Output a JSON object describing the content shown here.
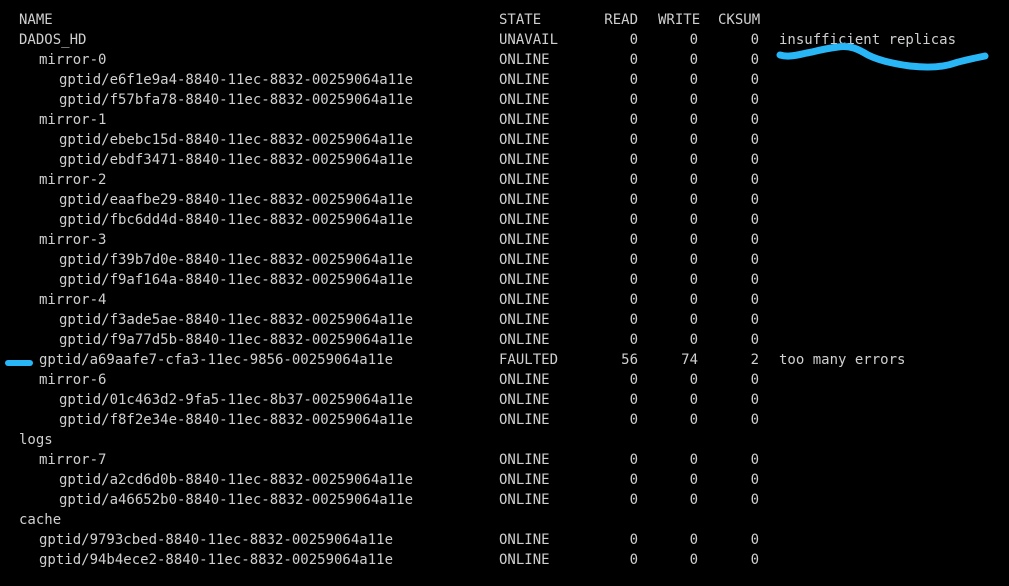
{
  "terminal": {
    "header": {
      "name": "NAME",
      "state": "STATE",
      "read": "READ",
      "write": "WRITE",
      "cksum": "CKSUM"
    },
    "rows": [
      {
        "name": "DADOS_HD",
        "state": "UNAVAIL",
        "read": "0",
        "write": "0",
        "cksum": "0",
        "msg": "insufficient replicas",
        "indent": 0
      },
      {
        "name": "mirror-0",
        "state": "ONLINE",
        "read": "0",
        "write": "0",
        "cksum": "0",
        "msg": "",
        "indent": 1
      },
      {
        "name": "gptid/e6f1e9a4-8840-11ec-8832-00259064a11e",
        "state": "ONLINE",
        "read": "0",
        "write": "0",
        "cksum": "0",
        "msg": "",
        "indent": 2
      },
      {
        "name": "gptid/f57bfa78-8840-11ec-8832-00259064a11e",
        "state": "ONLINE",
        "read": "0",
        "write": "0",
        "cksum": "0",
        "msg": "",
        "indent": 2
      },
      {
        "name": "mirror-1",
        "state": "ONLINE",
        "read": "0",
        "write": "0",
        "cksum": "0",
        "msg": "",
        "indent": 1
      },
      {
        "name": "gptid/ebebc15d-8840-11ec-8832-00259064a11e",
        "state": "ONLINE",
        "read": "0",
        "write": "0",
        "cksum": "0",
        "msg": "",
        "indent": 2
      },
      {
        "name": "gptid/ebdf3471-8840-11ec-8832-00259064a11e",
        "state": "ONLINE",
        "read": "0",
        "write": "0",
        "cksum": "0",
        "msg": "",
        "indent": 2
      },
      {
        "name": "mirror-2",
        "state": "ONLINE",
        "read": "0",
        "write": "0",
        "cksum": "0",
        "msg": "",
        "indent": 1
      },
      {
        "name": "gptid/eaafbe29-8840-11ec-8832-00259064a11e",
        "state": "ONLINE",
        "read": "0",
        "write": "0",
        "cksum": "0",
        "msg": "",
        "indent": 2
      },
      {
        "name": "gptid/fbc6dd4d-8840-11ec-8832-00259064a11e",
        "state": "ONLINE",
        "read": "0",
        "write": "0",
        "cksum": "0",
        "msg": "",
        "indent": 2
      },
      {
        "name": "mirror-3",
        "state": "ONLINE",
        "read": "0",
        "write": "0",
        "cksum": "0",
        "msg": "",
        "indent": 1
      },
      {
        "name": "gptid/f39b7d0e-8840-11ec-8832-00259064a11e",
        "state": "ONLINE",
        "read": "0",
        "write": "0",
        "cksum": "0",
        "msg": "",
        "indent": 2
      },
      {
        "name": "gptid/f9af164a-8840-11ec-8832-00259064a11e",
        "state": "ONLINE",
        "read": "0",
        "write": "0",
        "cksum": "0",
        "msg": "",
        "indent": 2
      },
      {
        "name": "mirror-4",
        "state": "ONLINE",
        "read": "0",
        "write": "0",
        "cksum": "0",
        "msg": "",
        "indent": 1
      },
      {
        "name": "gptid/f3ade5ae-8840-11ec-8832-00259064a11e",
        "state": "ONLINE",
        "read": "0",
        "write": "0",
        "cksum": "0",
        "msg": "",
        "indent": 2
      },
      {
        "name": "gptid/f9a77d5b-8840-11ec-8832-00259064a11e",
        "state": "ONLINE",
        "read": "0",
        "write": "0",
        "cksum": "0",
        "msg": "",
        "indent": 2
      },
      {
        "name": "gptid/a69aafe7-cfa3-11ec-9856-00259064a11e",
        "state": "FAULTED",
        "read": "56",
        "write": "74",
        "cksum": "2",
        "msg": "too many errors",
        "indent": 1
      },
      {
        "name": "mirror-6",
        "state": "ONLINE",
        "read": "0",
        "write": "0",
        "cksum": "0",
        "msg": "",
        "indent": 1
      },
      {
        "name": "gptid/01c463d2-9fa5-11ec-8b37-00259064a11e",
        "state": "ONLINE",
        "read": "0",
        "write": "0",
        "cksum": "0",
        "msg": "",
        "indent": 2
      },
      {
        "name": "gptid/f8f2e34e-8840-11ec-8832-00259064a11e",
        "state": "ONLINE",
        "read": "0",
        "write": "0",
        "cksum": "0",
        "msg": "",
        "indent": 2
      },
      {
        "name": "logs",
        "state": "",
        "read": "",
        "write": "",
        "cksum": "",
        "msg": "",
        "indent": 0
      },
      {
        "name": "mirror-7",
        "state": "ONLINE",
        "read": "0",
        "write": "0",
        "cksum": "0",
        "msg": "",
        "indent": 1
      },
      {
        "name": "gptid/a2cd6d0b-8840-11ec-8832-00259064a11e",
        "state": "ONLINE",
        "read": "0",
        "write": "0",
        "cksum": "0",
        "msg": "",
        "indent": 2
      },
      {
        "name": "gptid/a46652b0-8840-11ec-8832-00259064a11e",
        "state": "ONLINE",
        "read": "0",
        "write": "0",
        "cksum": "0",
        "msg": "",
        "indent": 2
      },
      {
        "name": "cache",
        "state": "",
        "read": "",
        "write": "",
        "cksum": "",
        "msg": "",
        "indent": 0
      },
      {
        "name": "gptid/9793cbed-8840-11ec-8832-00259064a11e",
        "state": "ONLINE",
        "read": "0",
        "write": "0",
        "cksum": "0",
        "msg": "",
        "indent": 1
      },
      {
        "name": "gptid/94b4ece2-8840-11ec-8832-00259064a11e",
        "state": "ONLINE",
        "read": "0",
        "write": "0",
        "cksum": "0",
        "msg": "",
        "indent": 1
      }
    ]
  },
  "colors": {
    "background": "#000000",
    "text": "#cfcfcf",
    "annotation": "#29b6f6"
  }
}
